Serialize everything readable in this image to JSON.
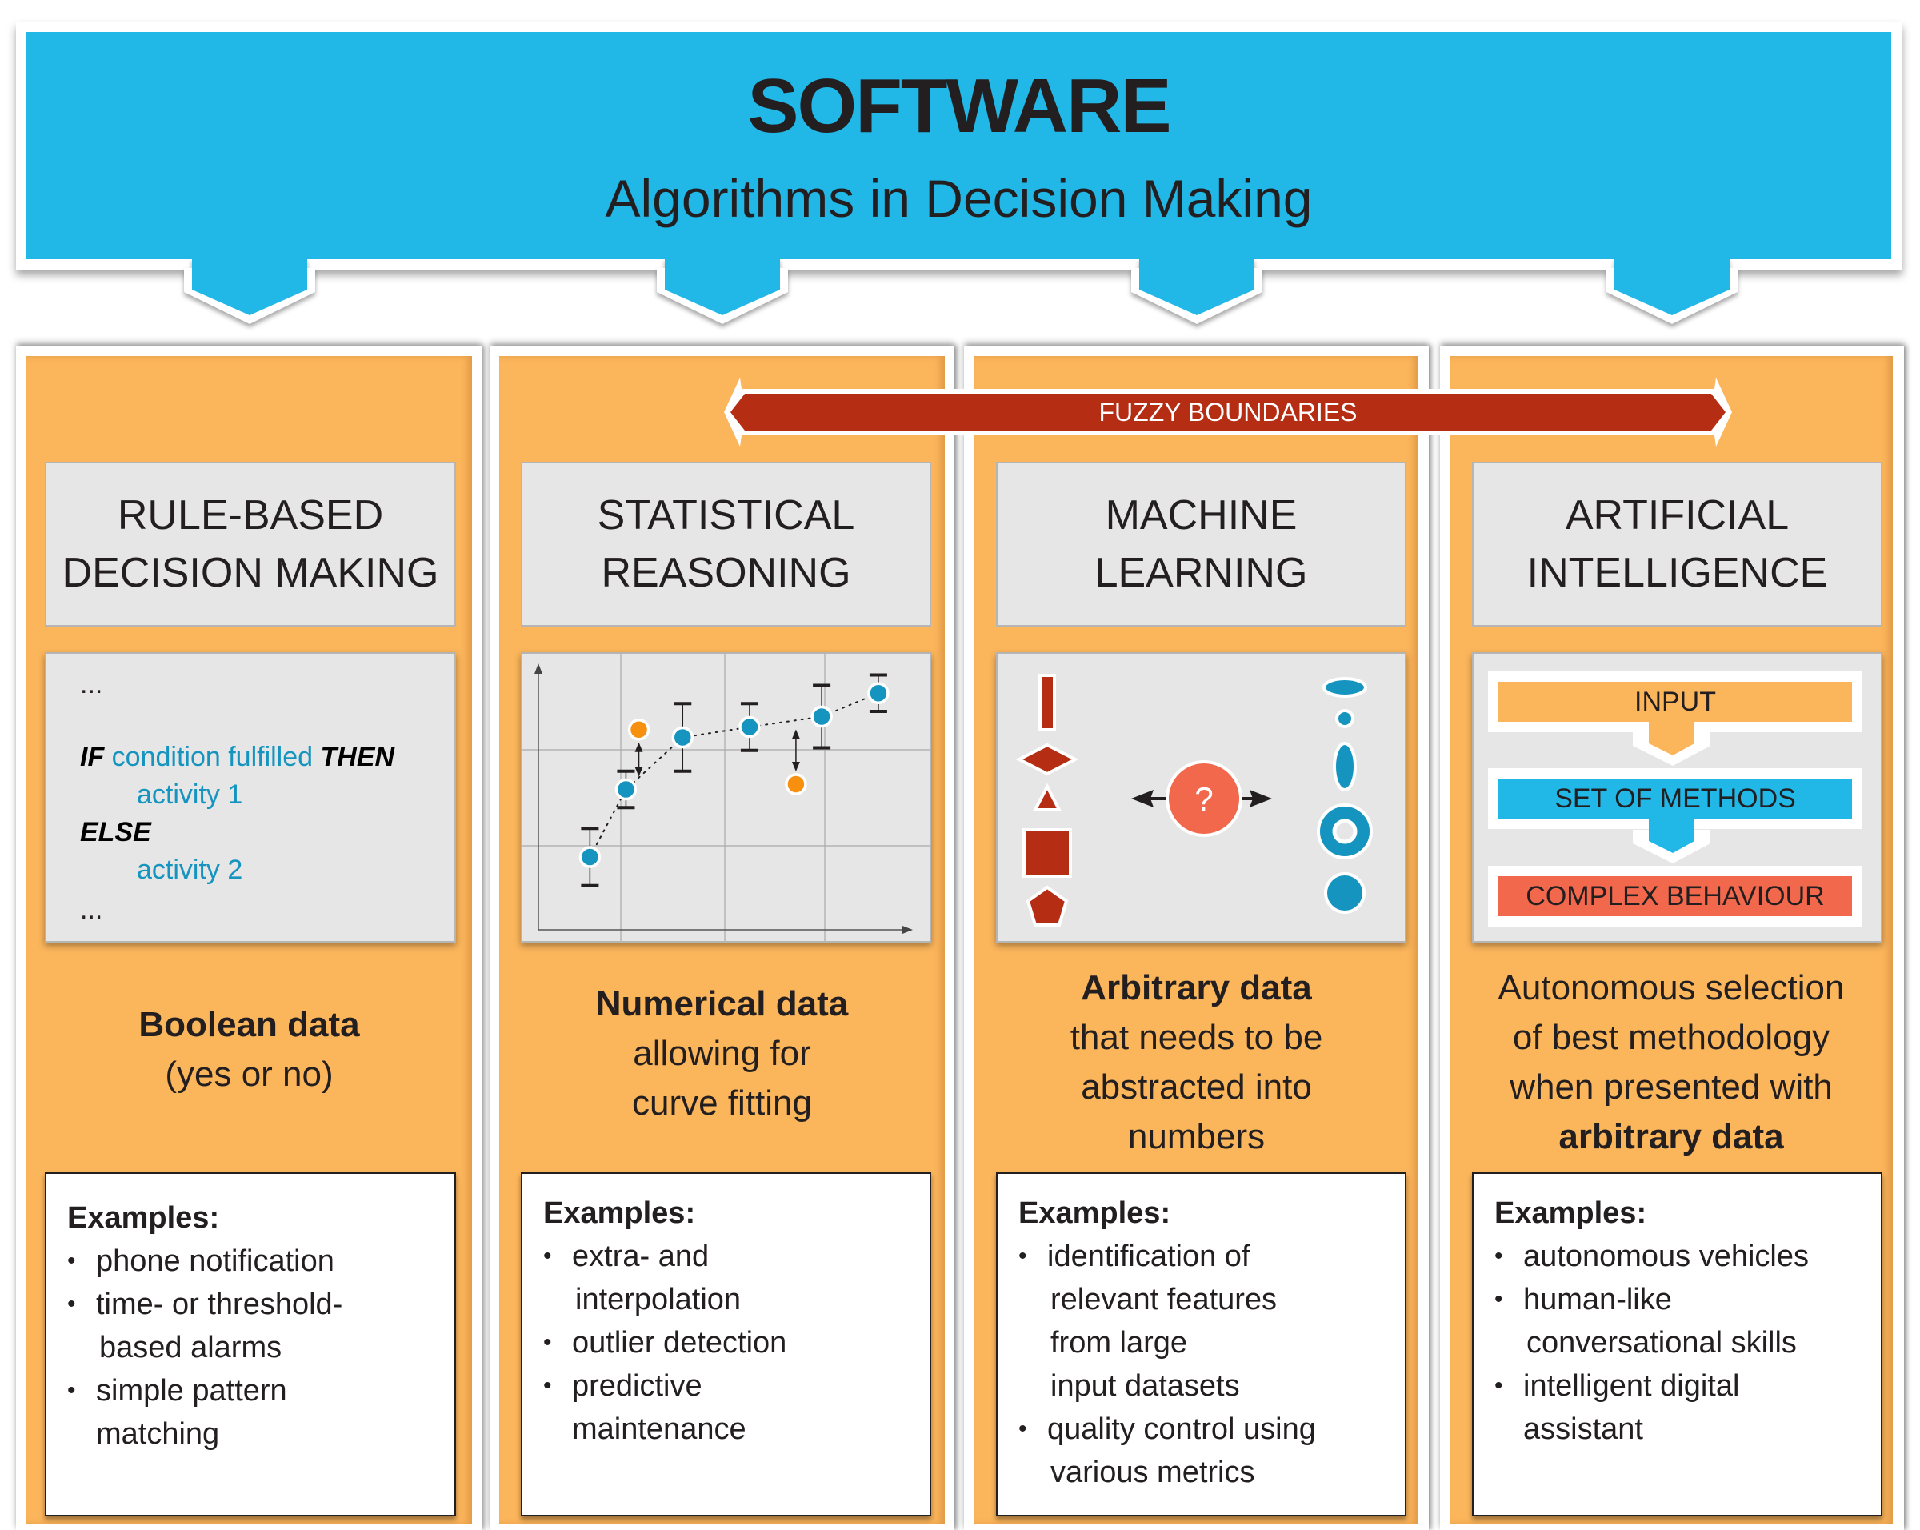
{
  "header": {
    "title": "SOFTWARE",
    "subtitle": "Algorithms in Decision Making"
  },
  "banner": {
    "label": "FUZZY BOUNDARIES"
  },
  "colors": {
    "header_blue": "#21b8e7",
    "column_orange": "#fbb55b",
    "banner_red": "#b52d13",
    "point_blue": "#1594bf",
    "point_orange": "#f78f0f",
    "shape_red": "#b52d13",
    "question_coral": "#f2684c",
    "flow_input": "#fbb55b",
    "flow_methods": "#21b8e7",
    "flow_behaviour": "#f2684c"
  },
  "columns": [
    {
      "heading_lines": [
        "RULE-BASED",
        "DECISION MAKING"
      ],
      "code": {
        "ellipsis_top": "...",
        "if_kw": "IF",
        "condition": "condition fulfilled",
        "then_kw": "THEN",
        "activity1": "activity 1",
        "else_kw": "ELSE",
        "activity2": "activity 2",
        "ellipsis_bottom": "..."
      },
      "desc": {
        "bold": "Boolean data",
        "rest": [
          "(yes or no)"
        ]
      },
      "examples_title": "Examples:",
      "examples": [
        [
          "phone notification"
        ],
        [
          "time- or threshold-",
          "based alarms"
        ],
        [
          "simple pattern",
          "matching"
        ]
      ]
    },
    {
      "heading_lines": [
        "STATISTICAL",
        "REASONING"
      ],
      "desc": {
        "bold": "Numerical data",
        "rest": [
          "allowing for",
          "curve fitting"
        ]
      },
      "examples_title": "Examples:",
      "examples": [
        [
          "extra- and",
          "interpolation"
        ],
        [
          "outlier detection"
        ],
        [
          "predictive",
          "maintenance"
        ]
      ]
    },
    {
      "heading_lines": [
        "MACHINE",
        "LEARNING"
      ],
      "question_mark": "?",
      "desc": {
        "bold": "Arbitrary data",
        "rest": [
          "that needs to be",
          "abstracted into",
          "numbers"
        ]
      },
      "examples_title": "Examples:",
      "examples": [
        [
          "identification of",
          "relevant features",
          "from large",
          "input datasets"
        ],
        [
          "quality control using",
          "various metrics"
        ]
      ]
    },
    {
      "heading_lines": [
        "ARTIFICIAL",
        "INTELLIGENCE"
      ],
      "flow": [
        "INPUT",
        "SET OF METHODS",
        "COMPLEX BEHAVIOUR"
      ],
      "desc": {
        "lines": [
          "Autonomous selection",
          "of best methodology",
          "when presented with"
        ],
        "bold_end": "arbitrary data"
      },
      "examples_title": "Examples:",
      "examples": [
        [
          "autonomous vehicles"
        ],
        [
          "human-like",
          "conversational skills"
        ],
        [
          "intelligent digital",
          "assistant"
        ]
      ]
    }
  ],
  "scatter_illustration": {
    "fit_points": [
      {
        "x": 1.0,
        "y": 1.4,
        "err_lo": 0.55,
        "err_hi": 0.55
      },
      {
        "x": 1.7,
        "y": 2.7,
        "err_lo": 0.35,
        "err_hi": 0.35
      },
      {
        "x": 2.8,
        "y": 3.7,
        "err_lo": 0.65,
        "err_hi": 0.65
      },
      {
        "x": 4.1,
        "y": 3.9,
        "err_lo": 0.45,
        "err_hi": 0.45
      },
      {
        "x": 5.5,
        "y": 4.1,
        "err_lo": 0.6,
        "err_hi": 0.6
      },
      {
        "x": 6.6,
        "y": 4.55,
        "err_lo": 0.35,
        "err_hi": 0.35
      }
    ],
    "outliers": [
      {
        "x": 1.95,
        "y": 3.85
      },
      {
        "x": 5.0,
        "y": 2.8
      }
    ]
  }
}
